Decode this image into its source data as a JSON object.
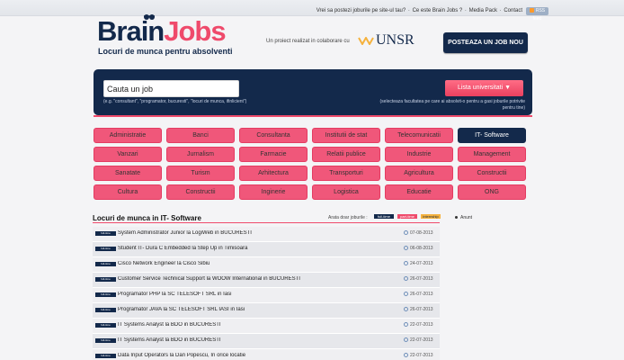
{
  "top": {
    "links": [
      "Vrei sa postezi joburile pe site-ul tau?",
      "Ce este Brain Jobs ?",
      "Media Pack",
      "Contact"
    ],
    "rss": "RSS feed"
  },
  "logo": {
    "part1": "Brain",
    "part2": "Jobs",
    "tagline": "Locuri de munca pentru absolventi"
  },
  "collab": {
    "text": "Un proiect realizat in colaborare cu",
    "partner": "UNSR"
  },
  "post_job": "POSTEAZA UN JOB NOU",
  "search": {
    "value": "Cauta un job",
    "hint": "(e.g. \"consultant\", \"programator, bucuresti\", \"locuri de munca, ifinlicient\")",
    "list_button": "Lista universitati ▼",
    "right_hint": "(selecteaza facultatea pe care ai absolvit-o pentru a gasi joburile potrivite pentru tine)"
  },
  "categories": [
    [
      "Administratie",
      "Banci",
      "Consultanta",
      "Institutii de stat",
      "Telecomunicatii",
      "IT- Software"
    ],
    [
      "Vanzari",
      "Jurnalism",
      "Farmacie",
      "Relatii publice",
      "Industrie",
      "Management"
    ],
    [
      "Sanatate",
      "Turism",
      "Arhitectura",
      "Transporturi",
      "Agricultura",
      "Constructii"
    ],
    [
      "Cultura",
      "Constructii",
      "Inginerie",
      "Logistica",
      "Educatie",
      "ONG"
    ]
  ],
  "section": {
    "title": "Locuri de munca in IT- Software",
    "show_label": "Arata doar joburile :",
    "filters": [
      "full-time",
      "part-time",
      "internship"
    ],
    "side": "Anunt"
  },
  "jobs": [
    {
      "badge": "full-time",
      "title": "System Administrator Junior la LogiWeb in BUCURESTI",
      "date": "07-08-2013"
    },
    {
      "badge": "full-time",
      "title": "Student IT- Dura C Embedded la Step Up in Timisoara",
      "date": "06-08-2013"
    },
    {
      "badge": "full-time",
      "title": "Cisco Network Engineer la Cisco Sibiu",
      "date": "24-07-2013"
    },
    {
      "badge": "full-time",
      "title": "Customer Service Technical Support la WOOW International in BUCURESTI",
      "date": "26-07-2013"
    },
    {
      "badge": "full-time",
      "title": "Programator PHP la SC TELESOFT SRL in Iasi",
      "date": "26-07-2013"
    },
    {
      "badge": "full-time",
      "title": "Programator JAVA la SC TELESOFT SRL IASI in Iasi",
      "date": "26-07-2013"
    },
    {
      "badge": "full-time",
      "title": "IT Systems Analyst la BDO in BUCURESTI",
      "date": "22-07-2013"
    },
    {
      "badge": "full-time",
      "title": "IT Systems Analyst la BDO in BUCURESTI",
      "date": "22-07-2013"
    },
    {
      "badge": "full-time",
      "title": "Data Input Operators la Dan Popescu, In orice locatie",
      "date": "22-07-2013"
    }
  ],
  "colors": {
    "navy": "#13294b",
    "pink": "#ef4a6b",
    "orange": "#f5b23e"
  }
}
